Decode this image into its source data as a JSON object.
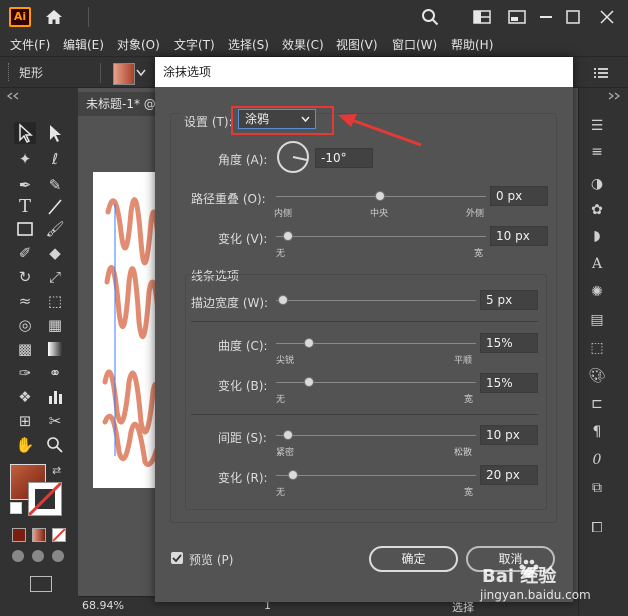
{
  "app": {
    "logo": "Ai"
  },
  "menu": [
    "文件(F)",
    "编辑(E)",
    "对象(O)",
    "文字(T)",
    "选择(S)",
    "效果(C)",
    "视图(V)",
    "窗口(W)",
    "帮助(H)"
  ],
  "control_bar": {
    "object_label": "矩形"
  },
  "document": {
    "tab_title": "未标题-1* @",
    "zoom": "68.94%",
    "page": "1",
    "status_right": "选择"
  },
  "colors": {
    "accent_stroke": "#e0866a",
    "fill_swatch": "#a8402a",
    "highlight_red": "#e53935",
    "arrow_red": "#e53935"
  },
  "dialog": {
    "title": "涂抹选项",
    "settings_label": "设置 (T):",
    "settings_value": "涂鸦",
    "angle_label": "角度 (A):",
    "angle_value": "-10°",
    "path_overlap_label": "路径重叠 (O):",
    "path_overlap_value": "0 px",
    "path_overlap_ticks": [
      "内侧",
      "中央",
      "外侧"
    ],
    "path_variation_label": "变化 (V):",
    "path_variation_value": "10 px",
    "path_variation_ticks": [
      "无",
      "宽"
    ],
    "line_options_label": "线条选项",
    "stroke_width_label": "描边宽度 (W):",
    "stroke_width_value": "5 px",
    "curviness_label": "曲度 (C):",
    "curviness_value": "15%",
    "curviness_ticks": [
      "尖锐",
      "平顺"
    ],
    "curviness_variation_label": "变化 (B):",
    "curviness_variation_value": "15%",
    "curviness_variation_ticks": [
      "无",
      "宽"
    ],
    "spacing_label": "间距 (S):",
    "spacing_value": "10 px",
    "spacing_ticks": [
      "紧密",
      "松散"
    ],
    "spacing_variation_label": "变化 (R):",
    "spacing_variation_value": "20 px",
    "spacing_variation_ticks": [
      "无",
      "宽"
    ],
    "preview_label": "预览 (P)",
    "preview_checked": true,
    "ok_label": "确定",
    "cancel_label": "取消"
  },
  "watermark": {
    "brand": "Bai 经验",
    "url": "jingyan.baidu.com"
  }
}
